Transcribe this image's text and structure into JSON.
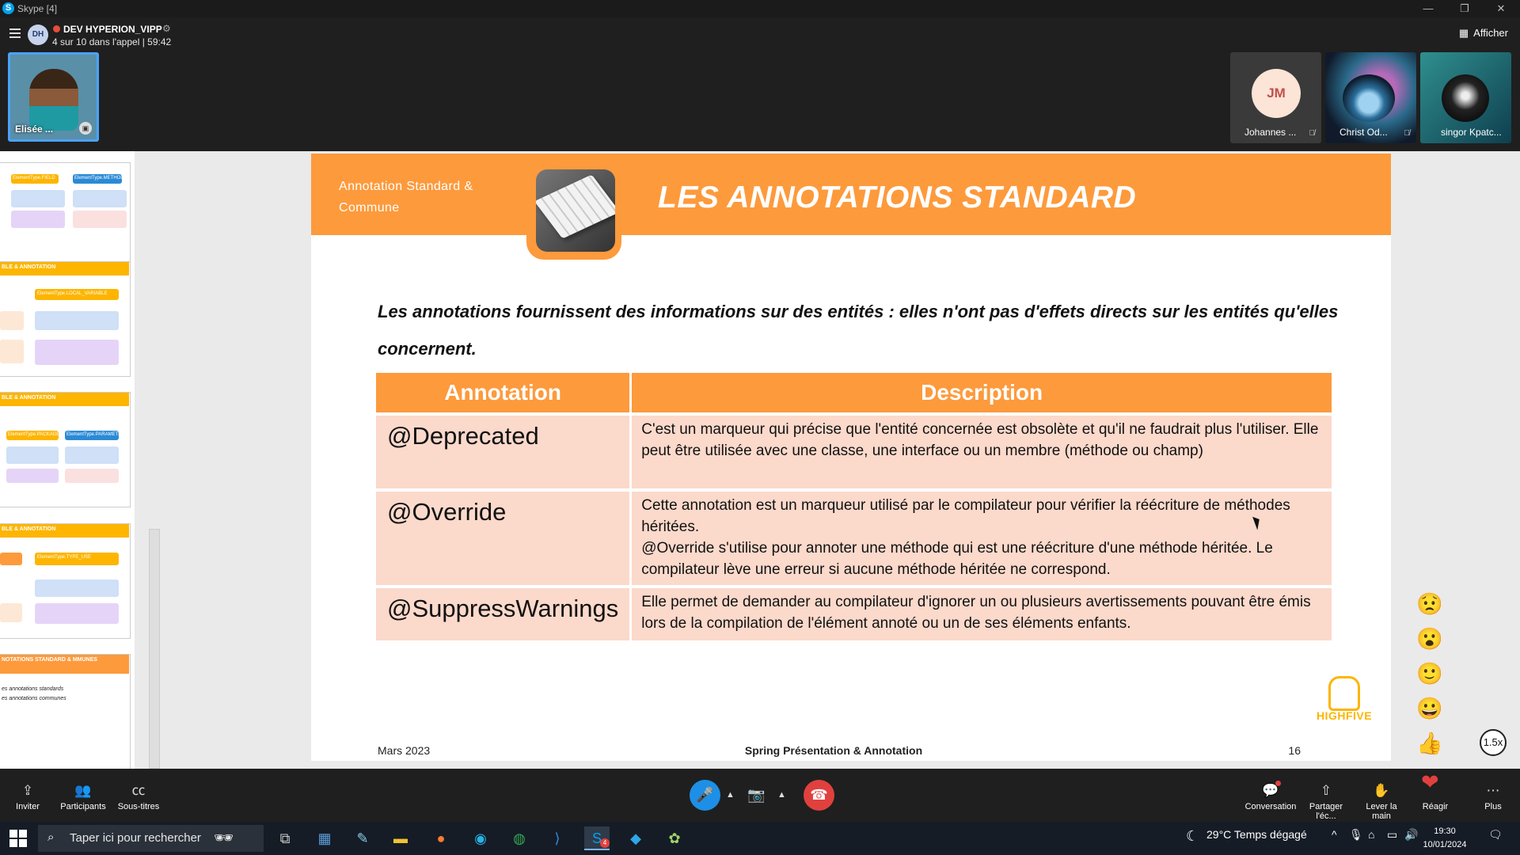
{
  "window": {
    "title": "Skype [4]",
    "minimize": "—",
    "restore": "❐",
    "close": "✕"
  },
  "call": {
    "group_initials": "DH",
    "group_name": "DEV HYPERION_VIPP",
    "status": "4 sur 10 dans l'appel | 59:42",
    "view_label": "Afficher"
  },
  "participants": {
    "self": {
      "name": "Elisée ..."
    },
    "remote": [
      {
        "name": "Johannes ...",
        "initials": "JM"
      },
      {
        "name": "Christ Od..."
      },
      {
        "name": "singor Kpatc..."
      }
    ]
  },
  "thumbnails": [
    {
      "header": "",
      "boxes": [
        "ElementType.FIELD",
        "ElementType.METHOD"
      ]
    },
    {
      "header": "BLE & ANNOTATION",
      "boxes": [
        "ElementType.LOCAL_VARIABLE"
      ]
    },
    {
      "header": "BLE & ANNOTATION",
      "boxes": [
        "ElementType.PACKAGE",
        "ElementType.PARAMETER"
      ]
    },
    {
      "header": "BLE & ANNOTATION",
      "boxes": [
        "ElementType.TYPE_USE"
      ]
    },
    {
      "header": "NOTATIONS STANDARD & MMUNES",
      "notes": [
        "es annotations standards",
        "es annotations communes"
      ]
    }
  ],
  "slide": {
    "banner_left_line1": "Annotation Standard &",
    "banner_left_line2": "Commune",
    "title": "LES ANNOTATIONS STANDARD",
    "intro": "Les annotations fournissent des informations sur des entités : elles n'ont pas d'effets directs sur les entités qu'elles concernent.",
    "table": {
      "headers": [
        "Annotation",
        "Description"
      ],
      "rows": [
        {
          "name": "@Deprecated",
          "desc": "C'est un marqueur qui précise que l'entité concernée est obsolète et qu'il ne faudrait plus l'utiliser. Elle peut être utilisée avec une classe, une interface ou un membre (méthode ou champ)"
        },
        {
          "name": "@Override",
          "desc": "Cette annotation est un marqueur utilisé par le compilateur pour vérifier la réécriture de méthodes héritées.",
          "desc2": "@Override s'utilise pour annoter une méthode qui est une réécriture d'une méthode héritée. Le compilateur lève une erreur si aucune méthode héritée ne correspond."
        },
        {
          "name": "@SuppressWarnings",
          "desc": "Elle permet de demander au compilateur d'ignorer un ou plusieurs avertissements pouvant être émis lors de la compilation de l'élément annoté ou un de ses éléments enfants."
        }
      ]
    },
    "footer_date": "Mars 2023",
    "footer_title": "Spring Présentation & Annotation",
    "page_number": "16",
    "logo_text": "HIGHFIVE"
  },
  "reactions": [
    "😟",
    "😮",
    "🙂",
    "😀",
    "👍"
  ],
  "speed": "1.5x",
  "controls": {
    "invite": "Inviter",
    "participants": "Participants",
    "captions": "Sous-titres",
    "conversation": "Conversation",
    "share": "Partager l'éc...",
    "raise_hand": "Lever la main",
    "react": "Réagir",
    "more": "Plus"
  },
  "taskbar": {
    "search_placeholder": "Taper ici pour rechercher",
    "weather": "29°C  Temps dégagé",
    "time": "19:30",
    "date": "10/01/2024",
    "skype_badge": "4"
  },
  "colors": {
    "accent": "#fd9a3c",
    "row_bg": "#fbd9cb",
    "skype_blue": "#1e8fe6",
    "hangup": "#e0413e"
  }
}
